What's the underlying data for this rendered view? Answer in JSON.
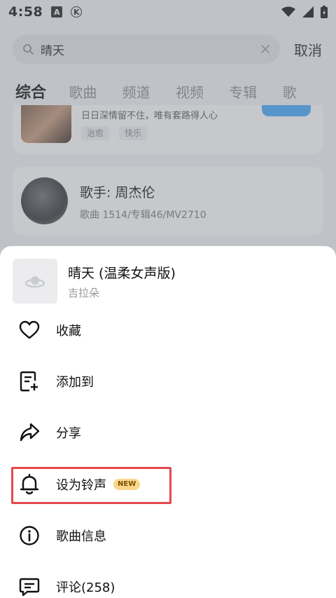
{
  "status_bar": {
    "time": "4:58",
    "badges": [
      "A",
      "K"
    ],
    "icons": [
      "wifi-icon",
      "signal-icon",
      "battery-charging-icon"
    ]
  },
  "search": {
    "query": "晴天",
    "cancel_label": "取消"
  },
  "tabs": [
    "综合",
    "歌曲",
    "频道",
    "视频",
    "专辑",
    "歌"
  ],
  "active_tab": "综合",
  "results": {
    "card1": {
      "description": "日日深情留不住，唯有套路得人心",
      "tags": [
        "治愈",
        "快乐"
      ]
    },
    "artist": {
      "title": "歌手: 周杰伦",
      "stats": "歌曲 1514/专辑46/MV2710"
    }
  },
  "sheet": {
    "song_title": "晴天 (温柔女声版)",
    "song_artist": "吉拉朵",
    "menu": [
      {
        "label": "收藏",
        "icon": "heart-icon"
      },
      {
        "label": "添加到",
        "icon": "add-to-playlist-icon"
      },
      {
        "label": "分享",
        "icon": "share-icon"
      },
      {
        "label": "设为铃声",
        "icon": "bell-icon",
        "badge": "NEW"
      },
      {
        "label": "歌曲信息",
        "icon": "info-icon"
      },
      {
        "label": "评论(258)",
        "icon": "comment-icon"
      }
    ]
  },
  "colors": {
    "accent": "#1e9bff",
    "highlight": "#e5484d",
    "new_badge": "#fbd68a"
  }
}
